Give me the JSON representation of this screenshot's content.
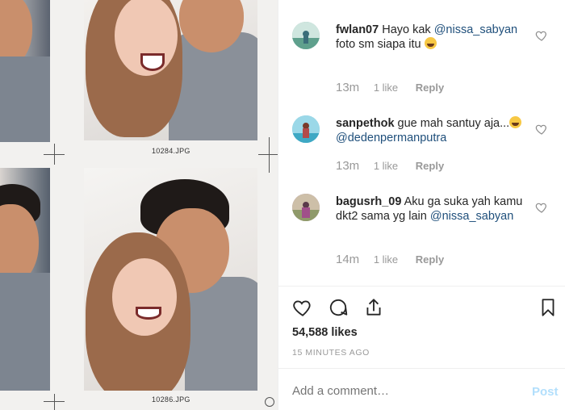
{
  "sheet": {
    "captions": [
      "10284.JPG",
      "10286.JPG"
    ]
  },
  "comments": [
    {
      "username": "fwlan07",
      "text_before": "Hayo kak",
      "mention": "@nissa_sabyan",
      "text_after": "foto sm siapa itu",
      "time": "13m",
      "likes": "1 like",
      "reply": "Reply",
      "avatar_color": "#7fb3a8"
    },
    {
      "username": "sanpethok",
      "text_before": "gue mah santuy aja...",
      "mention": "@dedenpermanputra",
      "text_after": "",
      "time": "13m",
      "likes": "1 like",
      "reply": "Reply",
      "avatar_color": "#6ec3d6"
    },
    {
      "username": "bagusrh_09",
      "text_before": "Aku ga suka yah kamu dkt2 sama yg lain",
      "mention": "@nissa_sabyan",
      "text_after": "",
      "time": "14m",
      "likes": "1 like",
      "reply": "Reply",
      "avatar_color": "#a77ea7"
    }
  ],
  "post": {
    "likes": "54,588 likes",
    "time_ago": "15 MINUTES AGO",
    "comment_placeholder": "Add a comment…",
    "post_label": "Post"
  },
  "icons": {
    "like": "heart-icon",
    "comment": "comment-bubble-icon",
    "share": "share-icon",
    "save": "bookmark-icon",
    "comment_like": "heart-outline-icon"
  },
  "colors": {
    "mention": "#1f4f7b",
    "post_disabled": "#b2dffc",
    "muted": "#999999"
  }
}
